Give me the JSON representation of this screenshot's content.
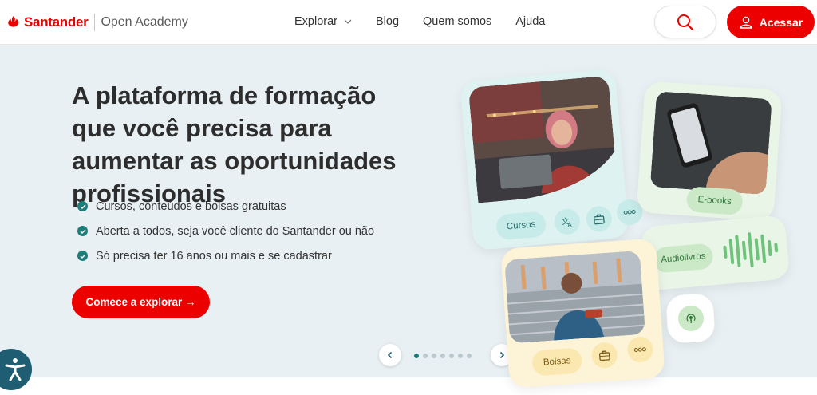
{
  "header": {
    "brand": "Santander",
    "subtitle": "Open Academy",
    "nav": [
      {
        "label": "Explorar"
      },
      {
        "label": "Blog"
      },
      {
        "label": "Quem somos"
      },
      {
        "label": "Ajuda"
      }
    ],
    "login_label": "Acessar",
    "colors": {
      "brand": "#ec0000",
      "teal": "#1c7d7a"
    }
  },
  "hero": {
    "title": "A plataforma de formação que você precisa para aumentar as oportunidades profissionais",
    "bullets": [
      "Cursos, conteúdos e bolsas gratuitas",
      "Aberta a todos, seja você cliente do Santander ou não",
      "Só precisa ter 16 anos ou mais e se cadastrar"
    ],
    "cta_label": "Comece a explorar →"
  },
  "cards": {
    "courses_label": "Cursos",
    "ebooks_label": "E-books",
    "audio_label": "Audiolivros",
    "bolsas_label": "Bolsas"
  },
  "carousel": {
    "total_slides": 7,
    "active_slide": 1
  },
  "icons": [
    "santander-flame-icon",
    "chevron-down-icon",
    "search-icon",
    "user-icon",
    "check-icon",
    "arrow-right-icon",
    "chevron-left-icon",
    "chevron-right-icon",
    "translate-icon",
    "briefcase-icon",
    "more-icon",
    "podcast-icon",
    "accessibility-icon"
  ]
}
